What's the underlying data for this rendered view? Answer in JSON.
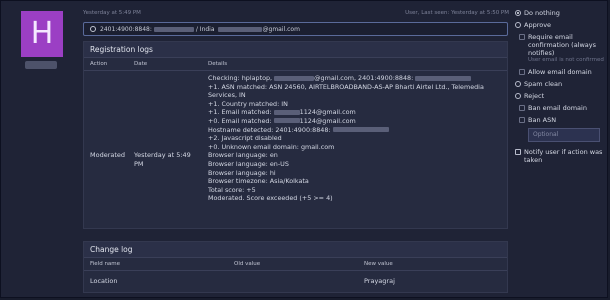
{
  "user": {
    "avatar_letter": "H"
  },
  "meta": {
    "left": "Yesterday at 5:49 PM",
    "right": "User, Last seen: Yesterday at 5:50 PM"
  },
  "ipbar": {
    "ip_prefix": "2401:4900:8848:",
    "location": "/ India",
    "email_suffix": "@gmail.com"
  },
  "registration_logs": {
    "title": "Registration logs",
    "columns": {
      "action": "Action",
      "date": "Date",
      "details": "Details"
    },
    "action": "Moderated",
    "date": "Yesterday at 5:49 PM",
    "details": {
      "checking_prefix": "Checking: hplaptop,",
      "checking_email": "@gmail.com, 2401:4900:8848:",
      "asn": "+1. ASN matched: ASN 24560, AIRTELBROADBAND-AS-AP Bharti Airtel Ltd., Telemedia Services, IN",
      "country": "+1. Country matched: IN",
      "email_matched_1_label": "+1. Email matched:",
      "email_matched_1_value": "1124@gmail.com",
      "email_matched_0_label": "+0. Email matched:",
      "email_matched_0_value": "1124@gmail.com",
      "hostname": "Hostname detected: 2401:4900:8848:",
      "js": "+2. Javascript disabled",
      "unknown_domain": "+0. Unknown email domain: gmail.com",
      "lang_en": "Browser language: en",
      "lang_en_us": "Browser language: en-US",
      "lang_hi": "Browser language: hi",
      "timezone": "Browser timezone: Asia/Kolkata",
      "total": "Total score: +5",
      "result": "Moderated. Score exceeded (+5 >= 4)"
    }
  },
  "change_log": {
    "title": "Change log",
    "columns": {
      "field": "Field name",
      "old": "Old value",
      "new": "New value"
    },
    "rows": [
      {
        "field": "Location",
        "old": "",
        "new": "Prayagraj"
      }
    ]
  },
  "actions": {
    "do_nothing": "Do nothing",
    "approve": "Approve",
    "require_email": "Require email confirmation (always notifies)",
    "require_email_hint": "User email is not confirmed",
    "allow_email_domain": "Allow email domain",
    "spam_clean": "Spam clean",
    "reject": "Reject",
    "ban_email_domain": "Ban email domain",
    "ban_asn": "Ban ASN",
    "optional_placeholder": "Optional",
    "notify_user": "Notify user if action was taken",
    "selected": "do_nothing"
  }
}
